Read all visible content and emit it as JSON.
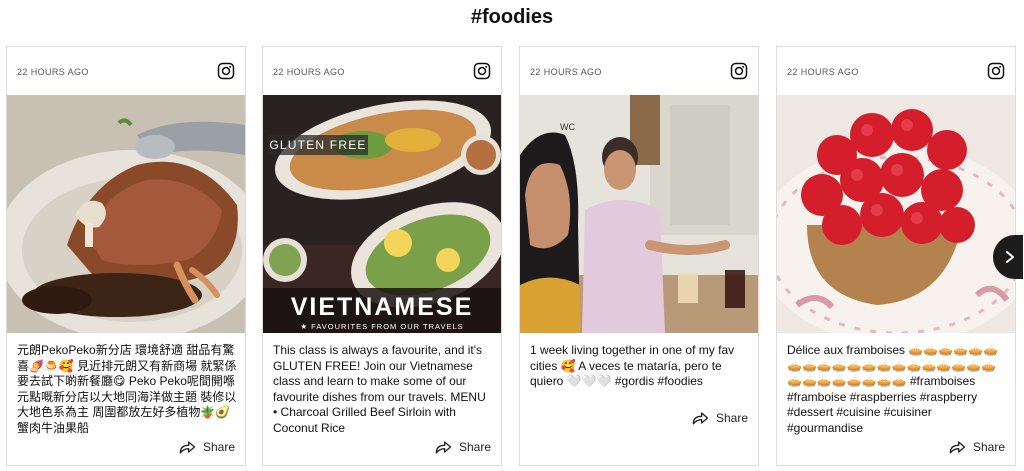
{
  "page": {
    "title": "#foodies"
  },
  "posts": [
    {
      "timestamp": "22 HOURS AGO",
      "caption": "元朗PekoPeko新分店 環境舒適 甜品有驚喜🍠🍮🥰 見近排元朗又有新商場 就緊係要去試下啲新餐廳😋 Peko Peko呢間開喺元點嘅新分店以大地同海洋做主題 裝修以大地色系為主 周圍都放左好多植物🪴🥑 蟹肉牛油果船",
      "share_label": "Share",
      "image_icon": "chocolate-dessert-photo"
    },
    {
      "timestamp": "22 HOURS AGO",
      "caption": "This class is always a favourite, and it's GLUTEN FREE! Join our Vietnamese class and learn to make some of our favourite dishes from our travels. MENU • Charcoal Grilled Beef Sirloin with Coconut Rice",
      "share_label": "Share",
      "image_icon": "vietnamese-food-photo",
      "overlay": {
        "badge": "GLUTEN FREE",
        "headline": "VIETNAMESE",
        "subline": "★ FAVOURITES FROM OUR TRAVELS"
      }
    },
    {
      "timestamp": "22 HOURS AGO",
      "caption": "1 week living together in one of my fav cities 🥰 A veces te mataría, pero te quiero 🤍🤍🤍 #gordis #foodies",
      "share_label": "Share",
      "image_icon": "selfie-restaurant-photo",
      "overlay": {
        "sign": "WC"
      }
    },
    {
      "timestamp": "22 HOURS AGO",
      "caption": "Délice aux framboises 🥧🥧🥧🥧🥧🥧🥧🥧🥧🥧🥧🥧🥧🥧🥧🥧🥧🥧🥧🥧🥧🥧🥧🥧🥧🥧🥧🥧 #framboises #framboise #raspberries #raspberry #dessert #cuisine #cuisiner #gourmandise",
      "share_label": "Share",
      "image_icon": "raspberry-tart-photo"
    }
  ],
  "icons": {
    "instagram": "instagram-icon",
    "share": "share-arrow-icon",
    "next": "chevron-right-icon"
  },
  "colors": {
    "card_border": "#dcdcdc",
    "title": "#111111",
    "next_button": "#1c1c1c"
  }
}
